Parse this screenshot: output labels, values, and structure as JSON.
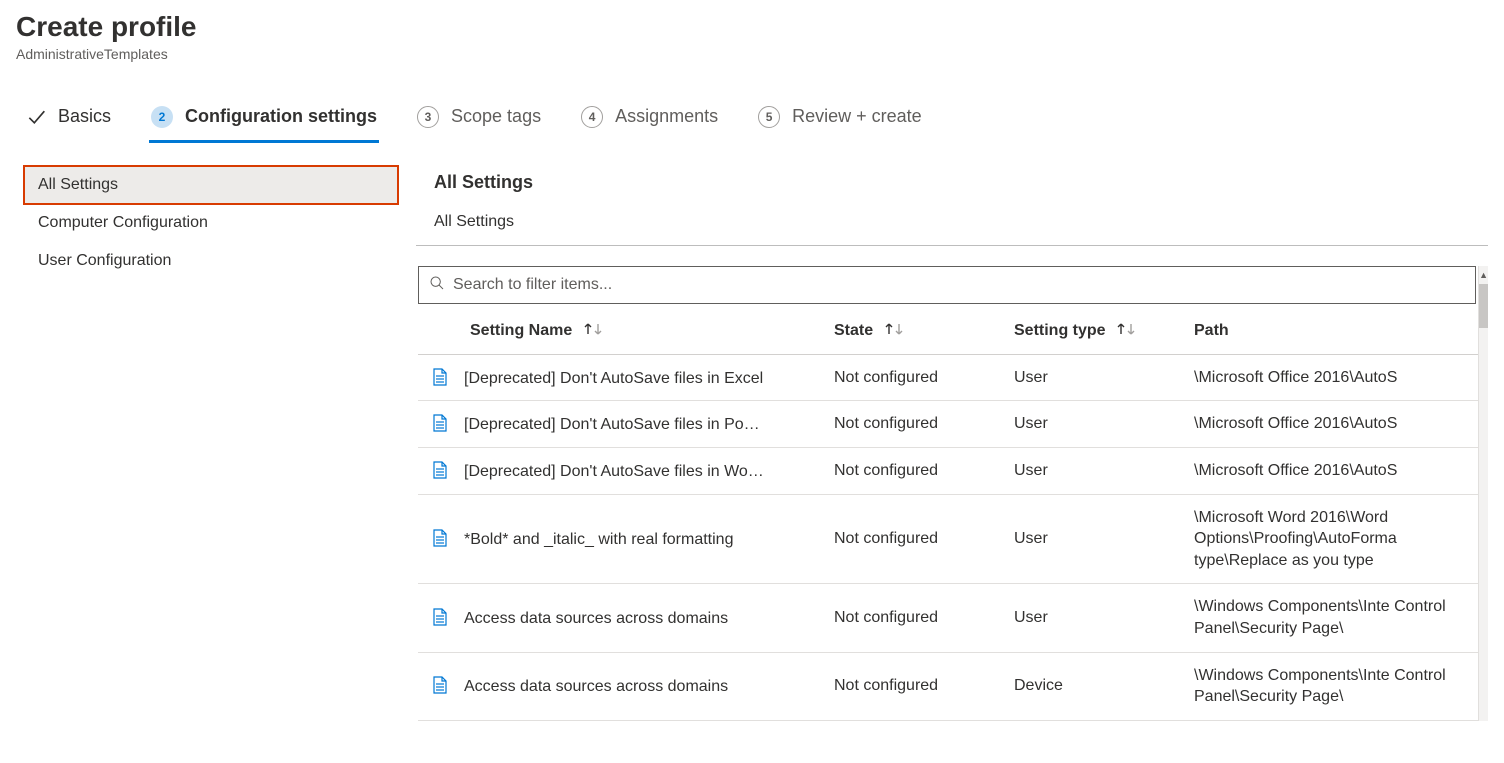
{
  "header": {
    "title": "Create profile",
    "subtitle": "AdministrativeTemplates"
  },
  "steps": [
    {
      "label": "Basics",
      "state": "done"
    },
    {
      "label": "Configuration settings",
      "state": "active",
      "num": "2"
    },
    {
      "label": "Scope tags",
      "state": "future",
      "num": "3"
    },
    {
      "label": "Assignments",
      "state": "future",
      "num": "4"
    },
    {
      "label": "Review + create",
      "state": "future",
      "num": "5"
    }
  ],
  "sidenav": {
    "items": [
      {
        "label": "All Settings",
        "active": true,
        "highlight": true
      },
      {
        "label": "Computer Configuration",
        "active": false
      },
      {
        "label": "User Configuration",
        "active": false
      }
    ]
  },
  "main": {
    "heading": "All Settings",
    "breadcrumb": "All Settings",
    "search_placeholder": "Search to filter items...",
    "columns": {
      "name": "Setting Name",
      "state": "State",
      "type": "Setting type",
      "path": "Path"
    },
    "rows": [
      {
        "name": "[Deprecated] Don't AutoSave files in Excel",
        "state": "Not configured",
        "type": "User",
        "path": "\\Microsoft Office 2016\\AutoS"
      },
      {
        "name": "[Deprecated] Don't AutoSave files in Po…",
        "state": "Not configured",
        "type": "User",
        "path": "\\Microsoft Office 2016\\AutoS"
      },
      {
        "name": "[Deprecated] Don't AutoSave files in Wo…",
        "state": "Not configured",
        "type": "User",
        "path": "\\Microsoft Office 2016\\AutoS"
      },
      {
        "name": "*Bold* and _italic_ with real formatting",
        "state": "Not configured",
        "type": "User",
        "path": "\\Microsoft Word 2016\\Word Options\\Proofing\\AutoForma type\\Replace as you type"
      },
      {
        "name": "Access data sources across domains",
        "state": "Not configured",
        "type": "User",
        "path": "\\Windows Components\\Inte Control Panel\\Security Page\\"
      },
      {
        "name": "Access data sources across domains",
        "state": "Not configured",
        "type": "Device",
        "path": "\\Windows Components\\Inte Control Panel\\Security Page\\"
      }
    ]
  }
}
